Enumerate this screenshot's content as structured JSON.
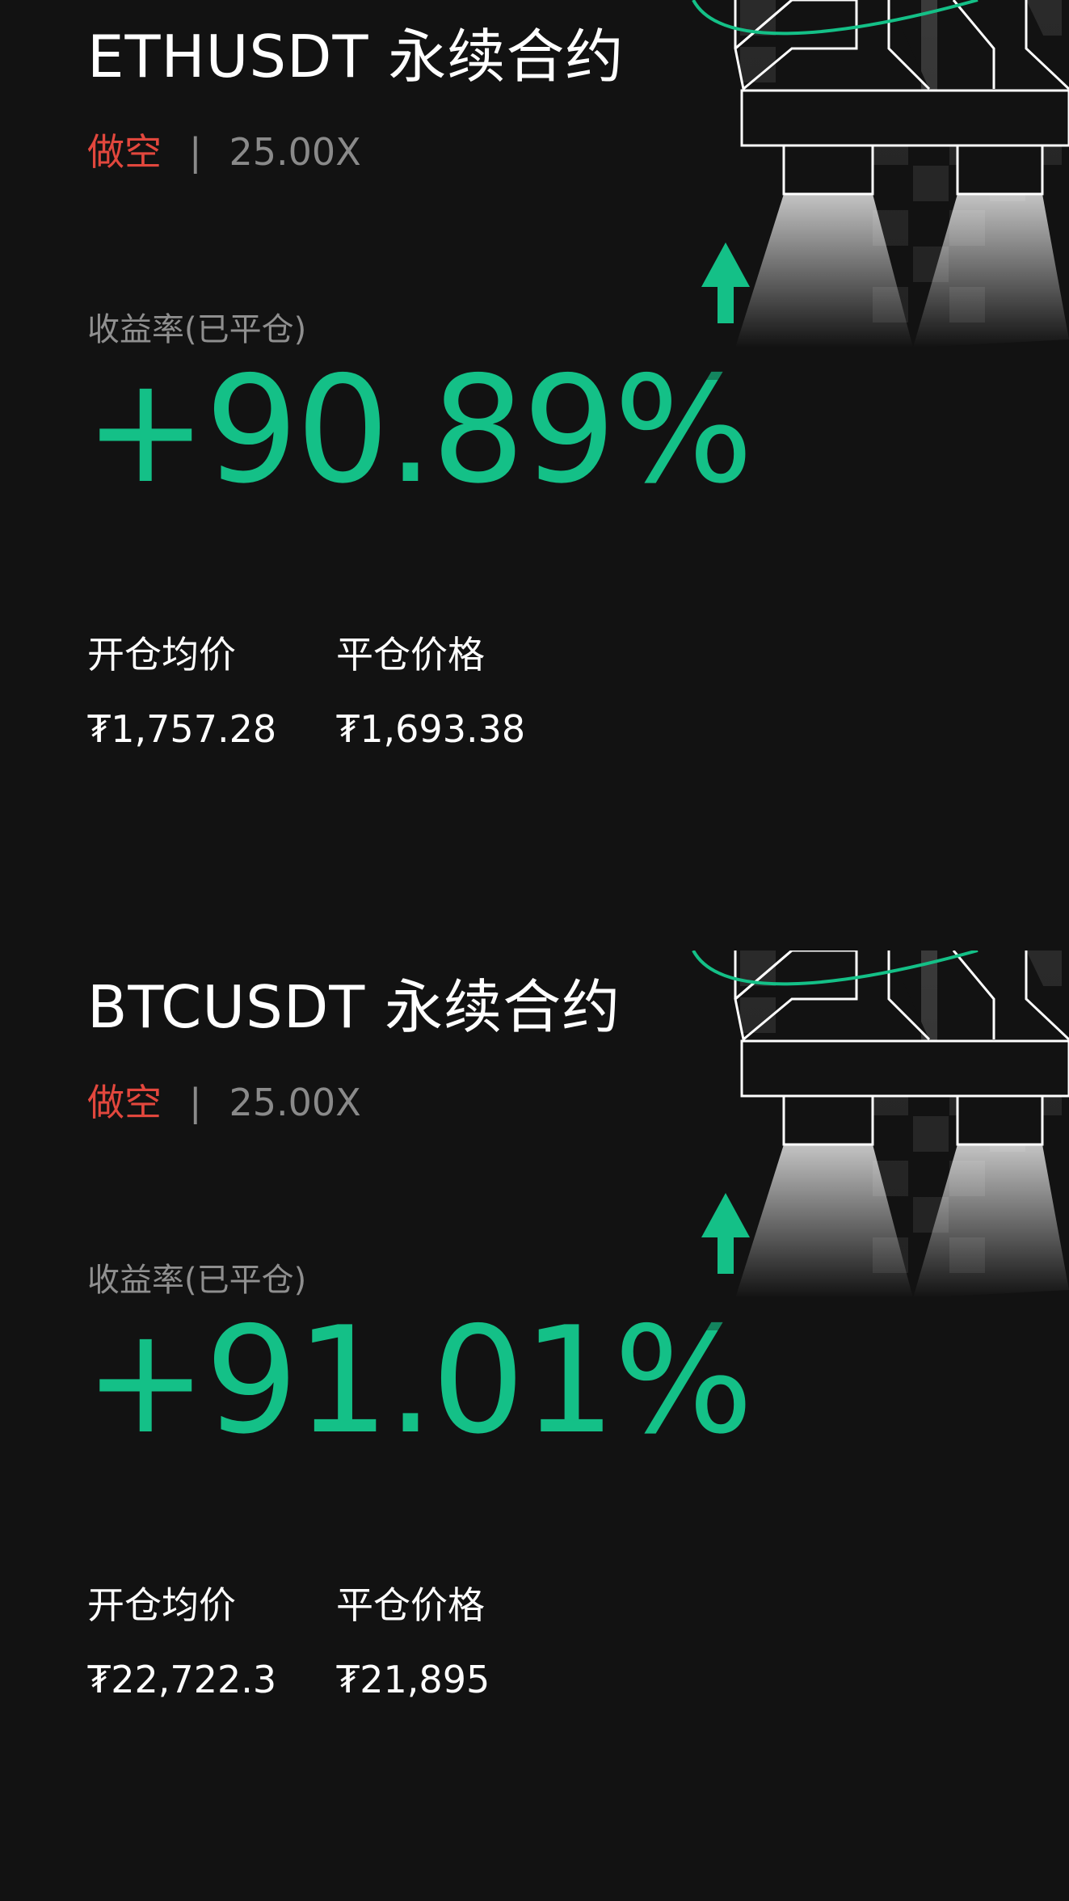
{
  "colors": {
    "background": "#121212",
    "profit_green": "#14c087",
    "short_red": "#e2473d",
    "muted_gray": "#8a8a8a"
  },
  "cards": [
    {
      "title": "ETHUSDT 永续合约",
      "direction": "做空",
      "separator": "|",
      "leverage": "25.00X",
      "pnl_label": "收益率(已平仓)",
      "pnl_value": "+90.89%",
      "open_label": "开仓均价",
      "open_value": "₮1,757.28",
      "close_label": "平仓价格",
      "close_value": "₮1,693.38",
      "illustration_icon": "rocket-illustration-icon",
      "arrow_icon": "up-arrow-icon"
    },
    {
      "title": "BTCUSDT 永续合约",
      "direction": "做空",
      "separator": "|",
      "leverage": "25.00X",
      "pnl_label": "收益率(已平仓)",
      "pnl_value": "+91.01%",
      "open_label": "开仓均价",
      "open_value": "₮22,722.3",
      "close_label": "平仓价格",
      "close_value": "₮21,895",
      "illustration_icon": "rocket-illustration-icon",
      "arrow_icon": "up-arrow-icon"
    }
  ]
}
